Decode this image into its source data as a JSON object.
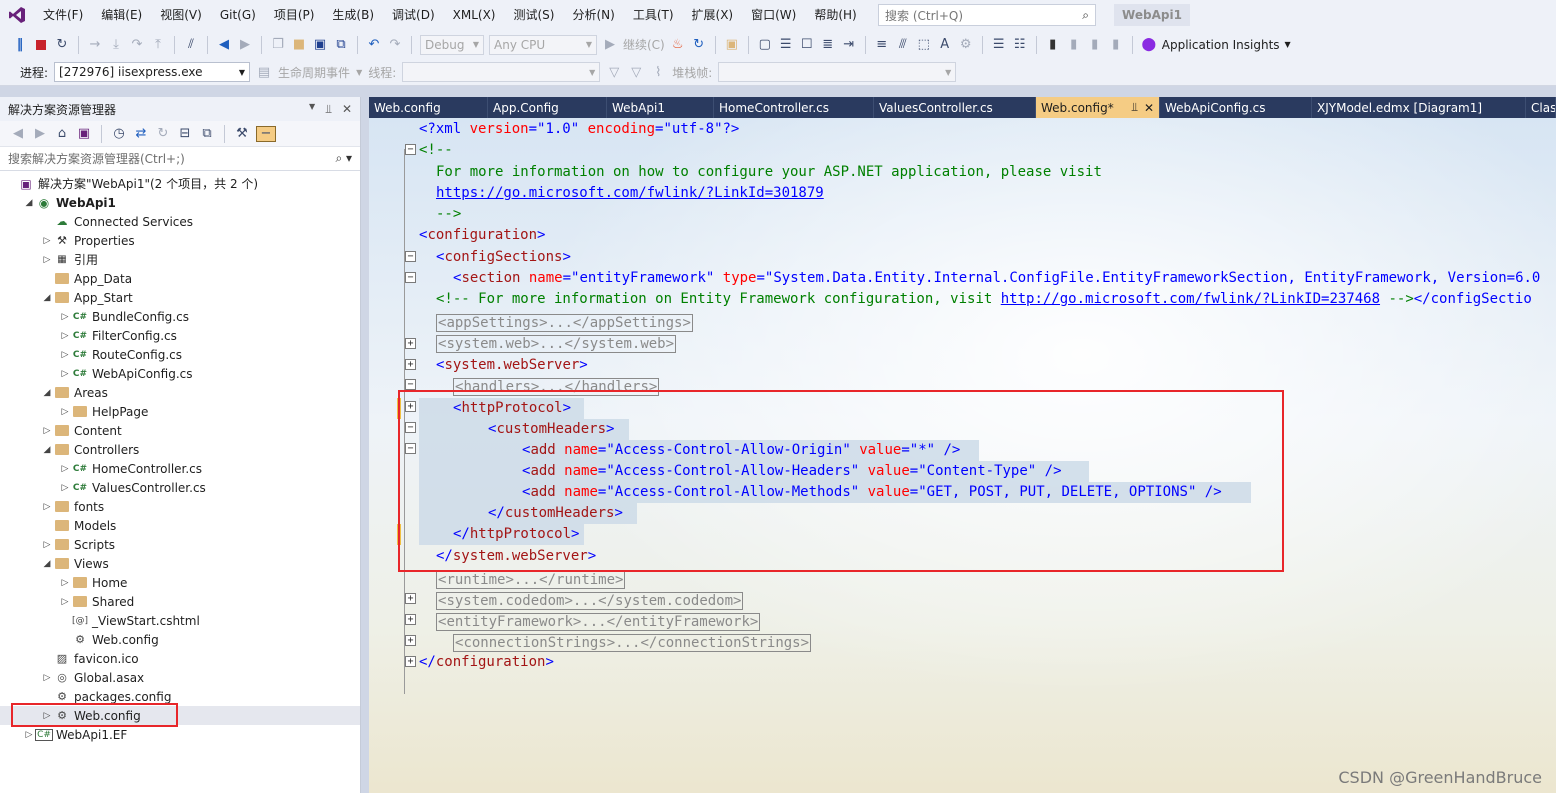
{
  "menu": {
    "items": [
      "文件(F)",
      "编辑(E)",
      "视图(V)",
      "Git(G)",
      "项目(P)",
      "生成(B)",
      "调试(D)",
      "XML(X)",
      "测试(S)",
      "分析(N)",
      "工具(T)",
      "扩展(X)",
      "窗口(W)",
      "帮助(H)"
    ],
    "search_placeholder": "搜索 (Ctrl+Q)",
    "app_title": "WebApi1"
  },
  "toolbar": {
    "config": "Debug",
    "platform": "Any CPU",
    "continue_label": "继续(C)",
    "insights_label": "Application Insights"
  },
  "debug_bar": {
    "process_label": "进程:",
    "process_value": "[272976] iisexpress.exe",
    "lifecycle_label": "生命周期事件",
    "thread_label": "线程:",
    "stackframe_label": "堆栈帧:"
  },
  "solution_explorer": {
    "title": "解决方案资源管理器",
    "search_placeholder": "搜索解决方案资源管理器(Ctrl+;)",
    "tree": [
      {
        "label": "解决方案\"WebApi1\"(2 个项目，共 2 个)",
        "level": 0,
        "arrow": "",
        "icon": "solution-icon"
      },
      {
        "label": "WebApi1",
        "level": 1,
        "arrow": "expanded",
        "icon": "web-project-icon",
        "bold": true
      },
      {
        "label": "Connected Services",
        "level": 2,
        "arrow": "",
        "icon": "connected-services-icon"
      },
      {
        "label": "Properties",
        "level": 2,
        "arrow": "collapsed",
        "icon": "wrench-icon"
      },
      {
        "label": "引用",
        "level": 2,
        "arrow": "collapsed",
        "icon": "references-icon"
      },
      {
        "label": "App_Data",
        "level": 2,
        "arrow": "",
        "icon": "folder-icon"
      },
      {
        "label": "App_Start",
        "level": 2,
        "arrow": "expanded",
        "icon": "folder-icon"
      },
      {
        "label": "BundleConfig.cs",
        "level": 3,
        "arrow": "collapsed",
        "icon": "csharp-icon"
      },
      {
        "label": "FilterConfig.cs",
        "level": 3,
        "arrow": "collapsed",
        "icon": "csharp-icon"
      },
      {
        "label": "RouteConfig.cs",
        "level": 3,
        "arrow": "collapsed",
        "icon": "csharp-icon"
      },
      {
        "label": "WebApiConfig.cs",
        "level": 3,
        "arrow": "collapsed",
        "icon": "csharp-icon"
      },
      {
        "label": "Areas",
        "level": 2,
        "arrow": "expanded",
        "icon": "folder-icon"
      },
      {
        "label": "HelpPage",
        "level": 3,
        "arrow": "collapsed",
        "icon": "folder-icon"
      },
      {
        "label": "Content",
        "level": 2,
        "arrow": "collapsed",
        "icon": "folder-icon"
      },
      {
        "label": "Controllers",
        "level": 2,
        "arrow": "expanded",
        "icon": "folder-icon"
      },
      {
        "label": "HomeController.cs",
        "level": 3,
        "arrow": "collapsed",
        "icon": "csharp-icon"
      },
      {
        "label": "ValuesController.cs",
        "level": 3,
        "arrow": "collapsed",
        "icon": "csharp-icon"
      },
      {
        "label": "fonts",
        "level": 2,
        "arrow": "collapsed",
        "icon": "folder-icon"
      },
      {
        "label": "Models",
        "level": 2,
        "arrow": "",
        "icon": "folder-icon"
      },
      {
        "label": "Scripts",
        "level": 2,
        "arrow": "collapsed",
        "icon": "folder-icon"
      },
      {
        "label": "Views",
        "level": 2,
        "arrow": "expanded",
        "icon": "folder-icon"
      },
      {
        "label": "Home",
        "level": 3,
        "arrow": "collapsed",
        "icon": "folder-icon"
      },
      {
        "label": "Shared",
        "level": 3,
        "arrow": "collapsed",
        "icon": "folder-icon"
      },
      {
        "label": "_ViewStart.cshtml",
        "level": 3,
        "arrow": "",
        "icon": "razor-icon"
      },
      {
        "label": "Web.config",
        "level": 3,
        "arrow": "",
        "icon": "config-icon"
      },
      {
        "label": "favicon.ico",
        "level": 2,
        "arrow": "",
        "icon": "image-icon"
      },
      {
        "label": "Global.asax",
        "level": 2,
        "arrow": "collapsed",
        "icon": "global-icon"
      },
      {
        "label": "packages.config",
        "level": 2,
        "arrow": "",
        "icon": "config-icon"
      },
      {
        "label": "Web.config",
        "level": 2,
        "arrow": "collapsed",
        "icon": "config-icon",
        "selected": true
      },
      {
        "label": "WebApi1.EF",
        "level": 1,
        "arrow": "collapsed",
        "icon": "csharp-project-icon"
      }
    ]
  },
  "tabs": [
    {
      "label": "Web.config",
      "active": false
    },
    {
      "label": "App.Config",
      "active": false
    },
    {
      "label": "WebApi1",
      "active": false
    },
    {
      "label": "HomeController.cs",
      "active": false
    },
    {
      "label": "ValuesController.cs",
      "active": false
    },
    {
      "label": "Web.config*",
      "active": true
    },
    {
      "label": "WebApiConfig.cs",
      "active": false
    },
    {
      "label": "XJYModel.edmx [Diagram1]",
      "active": false
    },
    {
      "label": "Clas",
      "active": false
    }
  ],
  "code": {
    "line01": {
      "p1": "<?xml ",
      "p2": "version",
      "p3": "=\"",
      "p4": "1.0",
      "p5": "\" ",
      "p6": "encoding",
      "p7": "=\"",
      "p8": "utf-8",
      "p9": "\"?>"
    },
    "line02": "<!--",
    "line03": "For more information on how to configure your ASP.NET application, please visit",
    "line04": "https://go.microsoft.com/fwlink/?LinkId=301879",
    "line05": "-->",
    "line06": {
      "open": "<",
      "tag": "configuration",
      "close": ">"
    },
    "line07": {
      "open": "<",
      "tag": "configSections",
      "close": ">"
    },
    "line08": {
      "open": "<",
      "tag": "section",
      "a1": " name",
      "eq1": "=\"",
      "v1": "entityFramework",
      "q1": "\" ",
      "a2": "type",
      "eq2": "=\"",
      "v2": "System.Data.Entity.Internal.ConfigFile.EntityFrameworkSection, EntityFramework, Version=6.0"
    },
    "line09": {
      "c1": "<!-- For more information on Entity Framework configuration, visit ",
      "link": "http://go.microsoft.com/fwlink/?LinkID=237468",
      "c2": " -->",
      "end": "</configSectio"
    },
    "line10": {
      "o": "<",
      "t": "appSettings",
      "m": ">...</",
      "t2": "appSettings",
      "c": ">"
    },
    "line11": {
      "o": "<",
      "t": "system.web",
      "m": ">...</",
      "t2": "system.web",
      "c": ">"
    },
    "line12": {
      "open": "<",
      "tag": "system.webServer",
      "close": ">"
    },
    "line13": {
      "o": "<",
      "t": "handlers",
      "m": ">...</",
      "t2": "handlers",
      "c": ">"
    },
    "line14": {
      "open": "<",
      "tag": "httpProtocol",
      "close": ">"
    },
    "line15": {
      "open": "<",
      "tag": "customHeaders",
      "close": ">"
    },
    "line16": {
      "o": "<",
      "t": "add",
      "a1": " name",
      "e1": "=\"",
      "v1": "Access-Control-Allow-Origin",
      "q1": "\" ",
      "a2": "value",
      "e2": "=\"",
      "v2": "*",
      "q2": "\" ",
      "c": "/>"
    },
    "line17": {
      "o": "<",
      "t": "add",
      "a1": " name",
      "e1": "=\"",
      "v1": "Access-Control-Allow-Headers",
      "q1": "\" ",
      "a2": "value",
      "e2": "=\"",
      "v2": "Content-Type",
      "q2": "\" ",
      "c": "/>"
    },
    "line18": {
      "o": "<",
      "t": "add",
      "a1": " name",
      "e1": "=\"",
      "v1": "Access-Control-Allow-Methods",
      "q1": "\" ",
      "a2": "value",
      "e2": "=\"",
      "v2": "GET, POST, PUT, DELETE, OPTIONS",
      "q2": "\" ",
      "c": "/>"
    },
    "line19": {
      "open": "</",
      "tag": "customHeaders",
      "close": ">"
    },
    "line20": {
      "open": "</",
      "tag": "httpProtocol",
      "close": ">"
    },
    "line21": {
      "open": "</",
      "tag": "system.webServer",
      "close": ">"
    },
    "line22": {
      "o": "<",
      "t": "runtime",
      "m": ">...</",
      "t2": "runtime",
      "c": ">"
    },
    "line23": {
      "o": "<",
      "t": "system.codedom",
      "m": ">...</",
      "t2": "system.codedom",
      "c": ">"
    },
    "line24": {
      "o": "<",
      "t": "entityFramework",
      "m": ">...</",
      "t2": "entityFramework",
      "c": ">"
    },
    "line25": {
      "o": "<",
      "t": "connectionStrings",
      "m": ">...</",
      "t2": "connectionStrings",
      "c": ">"
    },
    "line26": {
      "open": "</",
      "tag": "configuration",
      "close": ">"
    }
  },
  "watermark": "CSDN @GreenHandBruce",
  "colors": {
    "highlight_box": "#e8262a",
    "tab_active": "#f5cc84",
    "tab_bar": "#2a3a5f",
    "xml_tag": "#a31515",
    "xml_attr": "#ff0000",
    "xml_value": "#0000ff",
    "xml_comment": "#008000"
  }
}
